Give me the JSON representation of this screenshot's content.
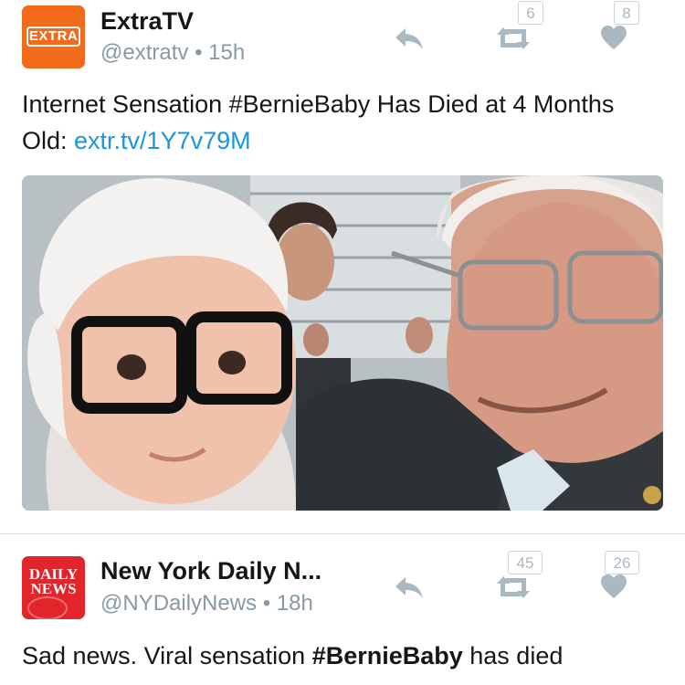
{
  "tweets": [
    {
      "avatar_logo": "EXTRA",
      "display_name": "ExtraTV",
      "handle": "@extratv",
      "separator": "•",
      "time": "15h",
      "text_before": "Internet Sensation #BernieBaby Has Died at 4 Months Old: ",
      "link": "extr.tv/1Y7v79M",
      "retweet_count": "6",
      "like_count": "8",
      "icons": [
        "reply-icon",
        "retweet-icon",
        "heart-icon"
      ]
    },
    {
      "avatar_logo_line1": "DAILY",
      "avatar_logo_line2": "NEWS",
      "display_name": "New York Daily N...",
      "handle": "@NYDailyNews",
      "separator": "•",
      "time": "18h",
      "text_before": "Sad news. Viral sensation ",
      "hashtag": "#BernieBaby",
      "text_after": " has died",
      "retweet_count": "45",
      "like_count": "26",
      "icons": [
        "reply-icon",
        "retweet-icon",
        "heart-icon"
      ]
    }
  ],
  "colors": {
    "link": "#1b95e0",
    "muted": "#8899a6",
    "extra_brand": "#f26a1b",
    "dailynews_brand": "#e2252a",
    "icon": "#aab8c2"
  }
}
